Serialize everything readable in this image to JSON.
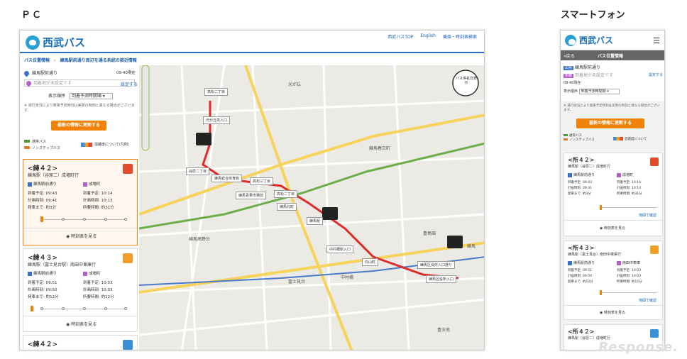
{
  "labels": {
    "pc": "ＰＣ",
    "smartphone": "スマートフォン"
  },
  "pc": {
    "logo_text": "西武バス",
    "top_links": [
      "西武バスTOP",
      "English",
      "乗換・時刻表検索"
    ],
    "breadcrumb": [
      "バス位置情報",
      "練馬駅前通り周辺を通る系統の接近情報"
    ],
    "departure_stop": "練馬駅前通り",
    "time_now": "09:40現在",
    "arrival_placeholder": "到着地が未設定です",
    "set_label": "設定する",
    "sort_label": "表示順序",
    "sort_value": "到着予測時間順",
    "notice": "※ 運行状況により発車予定時刻は実際の時刻と異なる場合がございます。",
    "update_button": "最新の情報に更新する",
    "legend_normal": "通常バス",
    "legend_nonstop": "ノンステップバス",
    "legend_crowd": "混雑度について(凡例)",
    "cards": [
      {
        "route": "<練４２>",
        "dest": "練馬駅（谷原二）成増町行",
        "from": "練馬駅前通り",
        "to": "成増町",
        "arr_label": "到着予定:",
        "arr_from": "09:43",
        "arr_to": "10:14",
        "plan_label": "計画時刻:",
        "plan_from": "09:41",
        "plan_to": "10:13",
        "wait_label": "発車まで:",
        "wait": "約3分",
        "dur_label": "所要時間:",
        "dur": "約31分",
        "timetable": "時刻表を見る"
      },
      {
        "route": "<練４３>",
        "dest": "練馬駅（富士見台駅）南田中車庫行",
        "from": "練馬駅前通り",
        "to": "成増町",
        "arr_label": "到着予定:",
        "arr_from": "09:51",
        "arr_to": "10:03",
        "plan_label": "計画時刻:",
        "plan_from": "09:50",
        "plan_to": "10:03",
        "wait_label": "発車まで:",
        "wait": "約12分",
        "dur_label": "所要時間:",
        "dur": "約12分",
        "timetable": "時刻表を見る"
      },
      {
        "route": "<練４２>"
      }
    ],
    "map_labels": [
      "高松二丁目",
      "光が丘高入口",
      "谷原二丁目",
      "練馬総合体育館",
      "高松三丁目",
      "練馬青果市場前",
      "高松二丁目",
      "練馬北町",
      "練馬駅",
      "中村橋駅入口",
      "向山町",
      "練馬区役所入口",
      "練馬区役所入口通り"
    ],
    "map_towns": [
      "光が丘",
      "練馬春日町",
      "練馬高野台",
      "富士見台",
      "中村橋",
      "豊島園",
      "練馬",
      "豊玉南"
    ],
    "map_badge": "バス停名非表示"
  },
  "sp": {
    "logo_text": "西武バス",
    "back": "«戻る",
    "bar_title": "バス位置情報",
    "dep_tag": "出発",
    "dep_stop": "練馬駅前通り",
    "arr_tag": "到着",
    "arr_placeholder": "到着地が未設定です",
    "set_label": "設定する",
    "time_now": "09:40現在",
    "sort_label": "表示順序",
    "sort_value": "到着予測時間順",
    "notice": "※ 運行状況により発車予定時刻は実際の時刻と異なる場合がございます。",
    "update_button": "最新の情報に更新する",
    "legend_normal": "通常バス",
    "legend_nonstop": "ノンステップバス",
    "legend_crowd": "混雑度について",
    "cards": [
      {
        "route": "<所４２>",
        "dest": "練馬駅（谷原二）成増町行",
        "from": "練馬駅前通り",
        "to": "成増町",
        "arr_from": "09:43",
        "arr_to": "10:14",
        "plan_from": "09:41",
        "plan_to": "10:13",
        "wait": "約3分",
        "dur": "約31分",
        "map_link": "地図で確認",
        "timetable": "時刻表を見る"
      },
      {
        "route": "<所４３>",
        "dest": "練馬駅（富士見台）南田中車庫行",
        "from": "練馬駅前通り",
        "to": "南田中車庫",
        "arr_from": "09:51",
        "arr_to": "10:03",
        "plan_from": "09:50",
        "plan_to": "10:03",
        "wait": "約12分",
        "dur": "約12分",
        "map_link": "地図で確認",
        "timetable": "時刻表を見る"
      },
      {
        "route": "<所４２>",
        "dest": "練馬駅（谷原二）成増町行"
      }
    ],
    "kv_arr": "到着予定:",
    "kv_plan": "計画時刻:",
    "kv_wait": "発車まで:",
    "kv_dur": "所要時間:"
  },
  "watermark": "Response."
}
